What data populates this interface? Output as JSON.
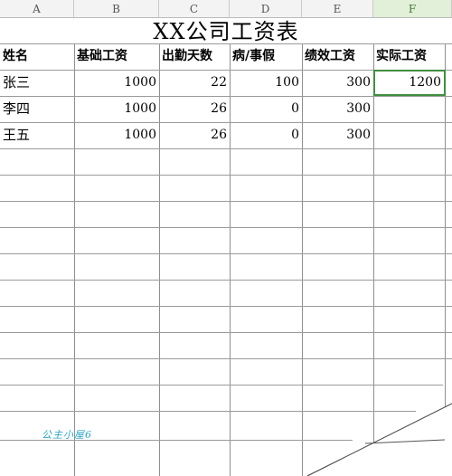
{
  "columns": [
    "A",
    "B",
    "C",
    "D",
    "E",
    "F"
  ],
  "active_column": "F",
  "title": "XX公司工资表",
  "headers": [
    "姓名",
    "基础工资",
    "出勤天数",
    "病/事假",
    "绩效工资",
    "实际工资"
  ],
  "rows": [
    {
      "name": "张三",
      "base": "1000",
      "days": "22",
      "leave": "100",
      "perf": "300",
      "actual": "1200"
    },
    {
      "name": "李四",
      "base": "1000",
      "days": "26",
      "leave": "0",
      "perf": "300",
      "actual": ""
    },
    {
      "name": "王五",
      "base": "1000",
      "days": "26",
      "leave": "0",
      "perf": "300",
      "actual": ""
    }
  ],
  "selected_cell": "F3",
  "watermark": "公主小屋6",
  "colors": {
    "selection": "#3f8f3f",
    "active_header": "#e2efd9",
    "grid": "#8f8f8f"
  }
}
